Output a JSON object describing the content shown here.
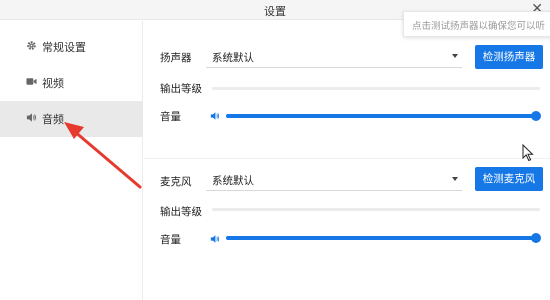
{
  "window": {
    "title": "设置",
    "close_glyph": "✕"
  },
  "toast": {
    "text": "点击测试扬声器以确保您可以听"
  },
  "sidebar": {
    "items": [
      {
        "label": "常规设置",
        "icon": "gear-icon",
        "active": false
      },
      {
        "label": "视频",
        "icon": "video-camera-icon",
        "active": false
      },
      {
        "label": "音频",
        "icon": "speaker-icon",
        "active": true
      }
    ]
  },
  "speaker": {
    "label": "扬声器",
    "device": "系统默认",
    "test_button": "检测扬声器",
    "level_label": "输出等级",
    "level": 0,
    "volume_label": "音量",
    "volume": 1.0
  },
  "microphone": {
    "label": "麦克风",
    "device": "系统默认",
    "test_button": "检测麦克风",
    "level_label": "输出等级",
    "level": 0,
    "volume_label": "音量",
    "volume": 1.0
  },
  "colors": {
    "accent": "#1677e6",
    "annotation_arrow": "#e63a2e",
    "active_nav": "#e9e9e9"
  }
}
